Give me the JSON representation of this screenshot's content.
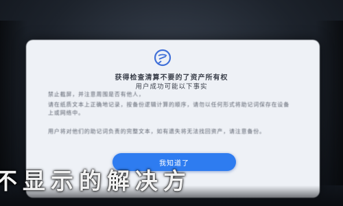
{
  "status_bar": {
    "text": ""
  },
  "dialog": {
    "icon": "shield-icon",
    "title": "获得检查清算不要的了资产所有权",
    "subtitle": "用户成功可能以下事实",
    "paragraphs": [
      "禁止截屏，并注意周围是否有他人，",
      "请在纸质文本上正确地记录，按备份逻辑计算的顺序，请勿以任何形式将助记词保存在设备上或网络中。",
      "用户将对他们的助记词负责的完整文本，如有遗失将无法找回资产，请注意备份。"
    ],
    "confirm_label": "我知道了"
  },
  "caption": "不显示的解决方",
  "colors": {
    "accent": "#2e7cf0",
    "dialog_bg": "#eef1f6",
    "page_bg": "#1d232c"
  }
}
